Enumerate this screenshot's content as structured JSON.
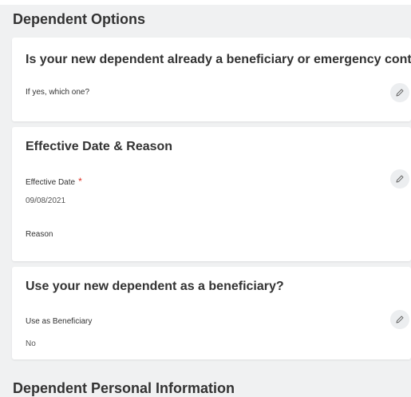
{
  "sections": {
    "dependent_options": "Dependent Options",
    "personal_info": "Dependent Personal Information"
  },
  "beneficiary_card": {
    "title": "Is your new dependent already a beneficiary or emergency contact?",
    "field_label": "If yes, which one?"
  },
  "effective_card": {
    "title": "Effective Date & Reason",
    "date_label": "Effective Date",
    "required_mark": "*",
    "date_value": "09/08/2021",
    "reason_label": "Reason"
  },
  "use_beneficiary_card": {
    "title": "Use your new dependent as a beneficiary?",
    "field_label": "Use as Beneficiary",
    "field_value": "No"
  },
  "icons": {
    "edit": "pencil-icon"
  },
  "colors": {
    "required": "#de2e21",
    "page_background": "#f0f1f2",
    "card_background": "#ffffff"
  }
}
